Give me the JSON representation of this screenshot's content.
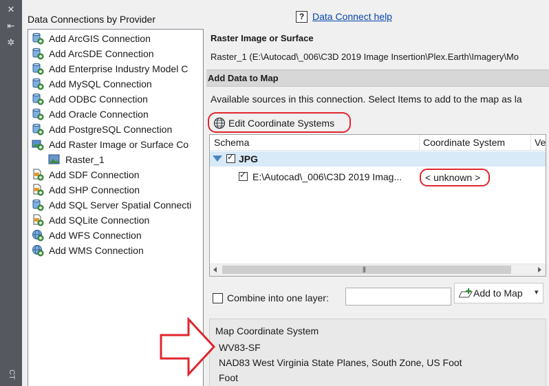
{
  "colors": {
    "highlight": "#e0262d",
    "link": "#0645ad",
    "selection": "#d8e9f7",
    "strip": "#55595f"
  },
  "left_strip": {
    "icons": [
      "close-icon",
      "pin-icon",
      "settings-icon"
    ],
    "bottom_label": "CT"
  },
  "providers": {
    "heading": "Data Connections by Provider",
    "items": [
      {
        "label": "Add ArcGIS Connection",
        "icon": "database-connect-icon"
      },
      {
        "label": "Add ArcSDE Connection",
        "icon": "database-connect-icon"
      },
      {
        "label": "Add Enterprise Industry Model C",
        "icon": "database-connect-icon"
      },
      {
        "label": "Add MySQL Connection",
        "icon": "database-connect-icon"
      },
      {
        "label": "Add ODBC Connection",
        "icon": "database-connect-icon"
      },
      {
        "label": "Add Oracle Connection",
        "icon": "database-connect-icon"
      },
      {
        "label": "Add PostgreSQL Connection",
        "icon": "database-connect-icon"
      },
      {
        "label": "Add Raster Image or Surface Co",
        "icon": "raster-connect-icon"
      },
      {
        "label": "Raster_1",
        "icon": "raster-image-icon"
      },
      {
        "label": "Add SDF Connection",
        "icon": "file-connect-icon"
      },
      {
        "label": "Add SHP Connection",
        "icon": "file-connect-icon"
      },
      {
        "label": "Add SQL Server Spatial Connecti",
        "icon": "database-connect-icon"
      },
      {
        "label": "Add SQLite Connection",
        "icon": "file-connect-icon"
      },
      {
        "label": "Add WFS Connection",
        "icon": "web-connect-icon"
      },
      {
        "label": "Add WMS Connection",
        "icon": "web-connect-icon"
      }
    ]
  },
  "help": {
    "icon_text": "?",
    "link_text": "Data Connect help"
  },
  "raster": {
    "heading": "Raster Image or Surface",
    "path": "Raster_1 (E:\\Autocad\\_006\\C3D 2019 Image Insertion\\Plex.Earth\\Imagery\\Mo"
  },
  "add_data": {
    "title": "Add Data to Map",
    "available_text": "Available sources in this connection.  Select Items to add to the map as la",
    "edit_cs_label": "Edit Coordinate Systems",
    "columns": [
      "Schema",
      "Coordinate System",
      "Ve"
    ],
    "group": {
      "label": "JPG",
      "checked": true
    },
    "item": {
      "name": "E:\\Autocad\\_006\\C3D 2019 Imag...",
      "coordinate_system": "< unknown >",
      "checked": true
    },
    "scroll_grip": "|||"
  },
  "combine": {
    "label": "Combine into one layer:",
    "checked": false,
    "value": ""
  },
  "add_to_map": {
    "label": "Add to Map",
    "caret": "▾"
  },
  "map_cs": {
    "title": "Map Coordinate System",
    "code": "WV83-SF",
    "description": "NAD83 West Virginia State Planes, South Zone, US Foot",
    "unit": "Foot"
  }
}
